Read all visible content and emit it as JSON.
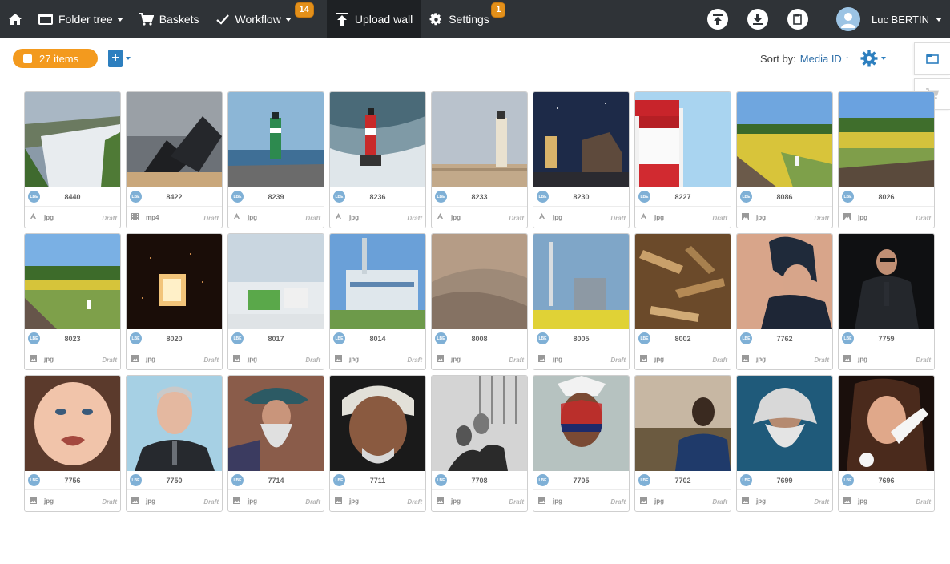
{
  "nav": {
    "home_icon": "home-icon",
    "folder_tree": "Folder tree",
    "baskets": "Baskets",
    "workflow": "Workflow",
    "workflow_badge": "14",
    "upload_wall": "Upload wall",
    "settings": "Settings",
    "settings_badge": "1",
    "user_name": "Luc BERTIN"
  },
  "toolbar": {
    "items_count": "27 items",
    "sort_label": "Sort by:",
    "sort_value": "Media ID ↑"
  },
  "colors": {
    "nav_bg": "#2f3337",
    "accent_orange": "#f39a1e",
    "accent_blue": "#2d7fbf",
    "badge": "#e3901a"
  },
  "cards": [
    {
      "id": "8440",
      "badge": "LBE",
      "type": "jpg",
      "type_icon": "text-icon",
      "status": "Draft",
      "thumb": "dam-spillway"
    },
    {
      "id": "8422",
      "badge": "LBE",
      "type": "mp4",
      "type_icon": "video-icon",
      "status": "Draft",
      "thumb": "solar-panels"
    },
    {
      "id": "8239",
      "badge": "LBE",
      "type": "jpg",
      "type_icon": "text-icon",
      "status": "Draft",
      "thumb": "green-lighthouse"
    },
    {
      "id": "8236",
      "badge": "LBE",
      "type": "jpg",
      "type_icon": "text-icon",
      "status": "Draft",
      "thumb": "red-lighthouse-sea"
    },
    {
      "id": "8233",
      "badge": "LBE",
      "type": "jpg",
      "type_icon": "text-icon",
      "status": "Draft",
      "thumb": "lighthouse-beach"
    },
    {
      "id": "8230",
      "badge": "LBE",
      "type": "jpg",
      "type_icon": "text-icon",
      "status": "Draft",
      "thumb": "lighthouse-night"
    },
    {
      "id": "8227",
      "badge": "LBE",
      "type": "jpg",
      "type_icon": "text-icon",
      "status": "Draft",
      "thumb": "red-white-lighthouse"
    },
    {
      "id": "8086",
      "badge": "LBE",
      "type": "jpg",
      "type_icon": "image-icon",
      "status": "Draft",
      "thumb": "railway-field"
    },
    {
      "id": "8026",
      "badge": "LBE",
      "type": "jpg",
      "type_icon": "image-icon",
      "status": "Draft",
      "thumb": "railway-field-2"
    },
    {
      "id": "8023",
      "badge": "LBE",
      "type": "jpg",
      "type_icon": "image-icon",
      "status": "Draft",
      "thumb": "railway-field-3"
    },
    {
      "id": "8020",
      "badge": "LBE",
      "type": "jpg",
      "type_icon": "image-icon",
      "status": "Draft",
      "thumb": "furnace-sparks"
    },
    {
      "id": "8017",
      "badge": "LBE",
      "type": "jpg",
      "type_icon": "image-icon",
      "status": "Draft",
      "thumb": "white-building"
    },
    {
      "id": "8014",
      "badge": "LBE",
      "type": "jpg",
      "type_icon": "image-icon",
      "status": "Draft",
      "thumb": "power-plant"
    },
    {
      "id": "8008",
      "badge": "LBE",
      "type": "jpg",
      "type_icon": "image-icon",
      "status": "Draft",
      "thumb": "sand-pile"
    },
    {
      "id": "8005",
      "badge": "LBE",
      "type": "jpg",
      "type_icon": "image-icon",
      "status": "Draft",
      "thumb": "factory-field"
    },
    {
      "id": "8002",
      "badge": "LBE",
      "type": "jpg",
      "type_icon": "image-icon",
      "status": "Draft",
      "thumb": "wood-chips"
    },
    {
      "id": "7762",
      "badge": "LBE",
      "type": "jpg",
      "type_icon": "image-icon",
      "status": "Draft",
      "thumb": "turban-portrait"
    },
    {
      "id": "7759",
      "badge": "LBE",
      "type": "jpg",
      "type_icon": "image-icon",
      "status": "Draft",
      "thumb": "man-with-gun"
    },
    {
      "id": "7756",
      "badge": "LBE",
      "type": "jpg",
      "type_icon": "image-icon",
      "status": "Draft",
      "thumb": "crying-baby"
    },
    {
      "id": "7750",
      "badge": "LBE",
      "type": "jpg",
      "type_icon": "image-icon",
      "status": "Draft",
      "thumb": "businessman-portrait"
    },
    {
      "id": "7714",
      "badge": "LBE",
      "type": "jpg",
      "type_icon": "image-icon",
      "status": "Draft",
      "thumb": "old-man-hat"
    },
    {
      "id": "7711",
      "badge": "LBE",
      "type": "jpg",
      "type_icon": "image-icon",
      "status": "Draft",
      "thumb": "elder-headscarf"
    },
    {
      "id": "7708",
      "badge": "LBE",
      "type": "jpg",
      "type_icon": "image-icon",
      "status": "Draft",
      "thumb": "couple-bw"
    },
    {
      "id": "7705",
      "badge": "LBE",
      "type": "jpg",
      "type_icon": "image-icon",
      "status": "Draft",
      "thumb": "face-paint"
    },
    {
      "id": "7702",
      "badge": "LBE",
      "type": "jpg",
      "type_icon": "image-icon",
      "status": "Draft",
      "thumb": "man-road"
    },
    {
      "id": "7699",
      "badge": "LBE",
      "type": "jpg",
      "type_icon": "image-icon",
      "status": "Draft",
      "thumb": "long-white-beard"
    },
    {
      "id": "7696",
      "badge": "LBE",
      "type": "jpg",
      "type_icon": "image-icon",
      "status": "Draft",
      "thumb": "woman-phone"
    }
  ]
}
